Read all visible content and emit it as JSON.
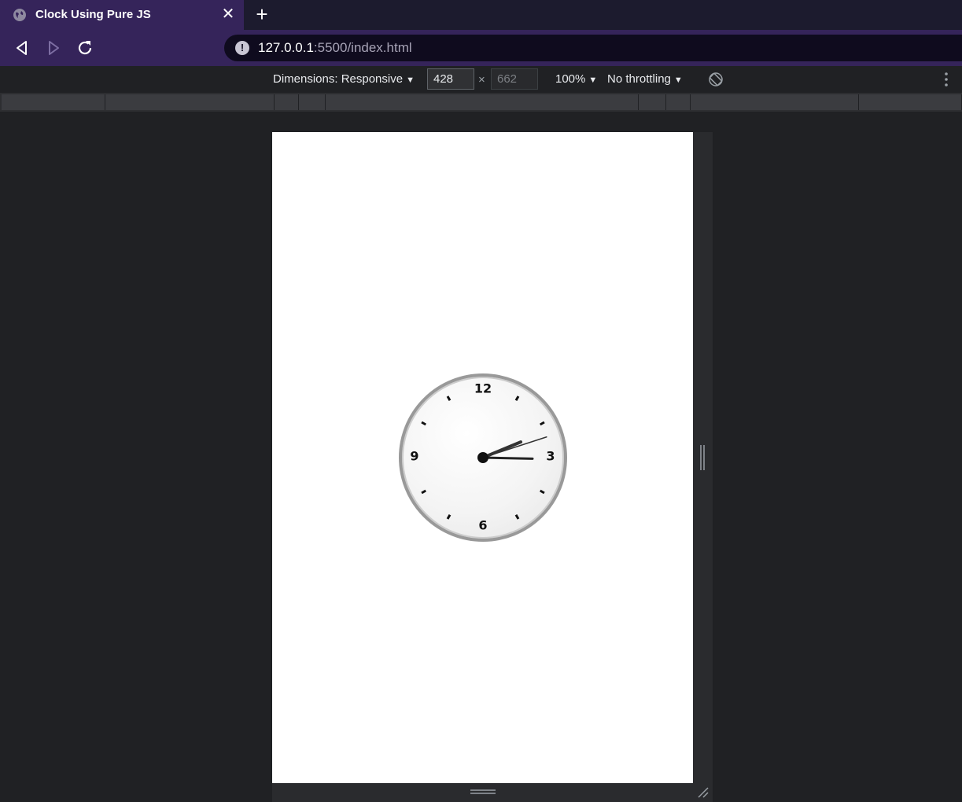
{
  "tab": {
    "title": "Clock Using Pure JS",
    "close_glyph": "✕",
    "new_tab_glyph": "+"
  },
  "address_bar": {
    "url_host": "127.0.0.1",
    "url_rest": ":5500/index.html",
    "security_glyph": "!"
  },
  "device_toolbar": {
    "dimensions_label": "Dimensions: Responsive",
    "width": "428",
    "height": "662",
    "times": "×",
    "zoom": "100%",
    "throttling": "No throttling",
    "caret": "▼"
  },
  "clock": {
    "numerals": {
      "twelve": "12",
      "three": "3",
      "six": "6",
      "nine": "9"
    },
    "time": {
      "hour": 2,
      "minute": 15,
      "second": 12
    }
  },
  "colors": {
    "tab_bg": "#35245a",
    "tabstrip_bg": "#1c1b2e",
    "omnibox_bg": "#0f0b1e",
    "devtools_bg": "#202124",
    "clock_rim": "#999999"
  }
}
